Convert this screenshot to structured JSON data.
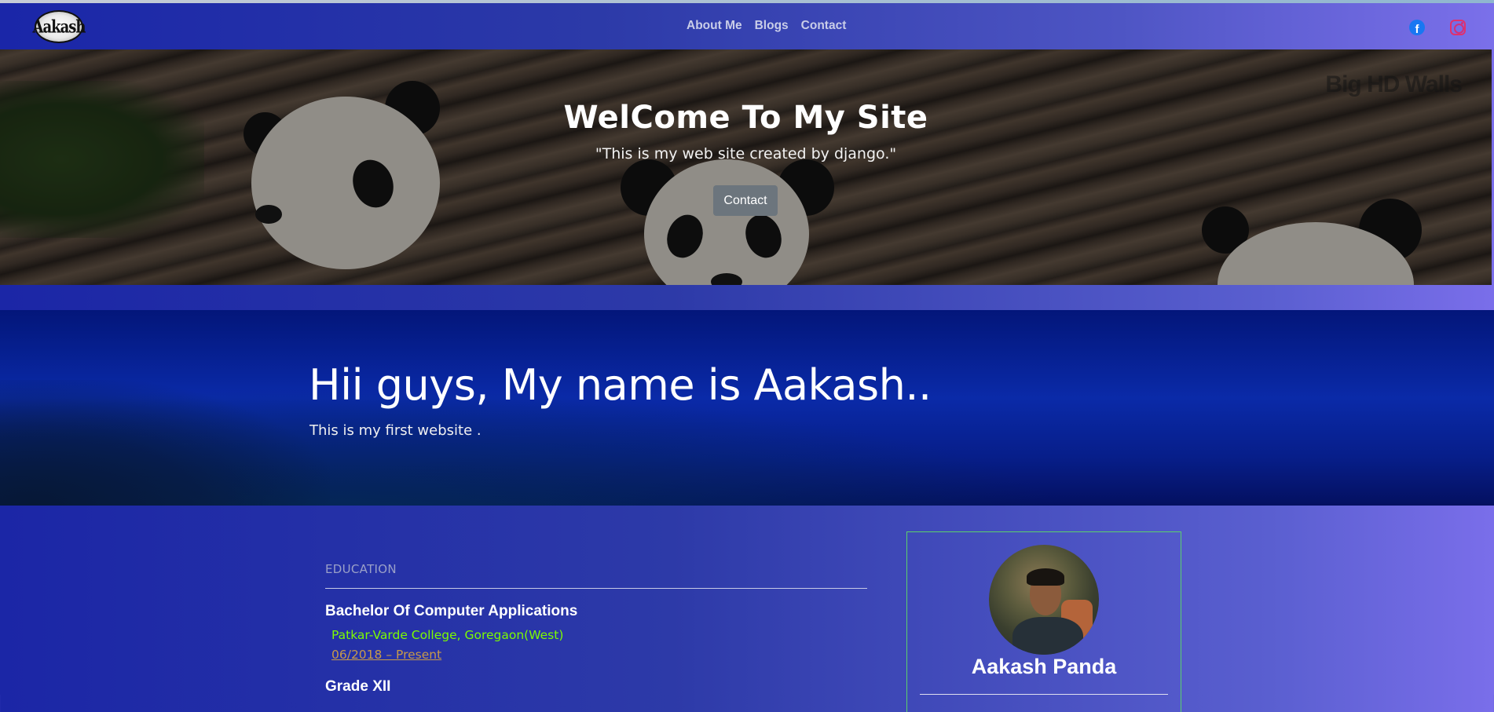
{
  "navbar": {
    "logo_text": "Aakash",
    "links": [
      "About Me",
      "Blogs",
      "Contact"
    ],
    "social": {
      "facebook_icon": "facebook-icon",
      "facebook_glyph": "f",
      "instagram_icon": "instagram-icon"
    }
  },
  "hero": {
    "watermark": "Big HD Walls",
    "title": "WelCome To My Site",
    "subtitle": "\"This is my web site created by django.\"",
    "button_label": "Contact"
  },
  "intro": {
    "heading": "Hii guys, My name is Aakash..",
    "text": "This is my first website ."
  },
  "education": {
    "heading": "EDUCATION",
    "entries": [
      {
        "degree": "Bachelor Of Computer Applications",
        "college": "Patkar-Varde College, Goregaon(West)",
        "dates": "06/2018 – Present"
      },
      {
        "degree": "Grade XII"
      }
    ]
  },
  "profile": {
    "name": "Aakash Panda"
  },
  "colors": {
    "nav_gradient_start": "#1a26a8",
    "nav_gradient_end": "#7b70ea",
    "college_text": "#7cfc00",
    "dates_text": "#c79a4a",
    "button_bg": "#6c757d",
    "card_border": "#5bd16b"
  }
}
